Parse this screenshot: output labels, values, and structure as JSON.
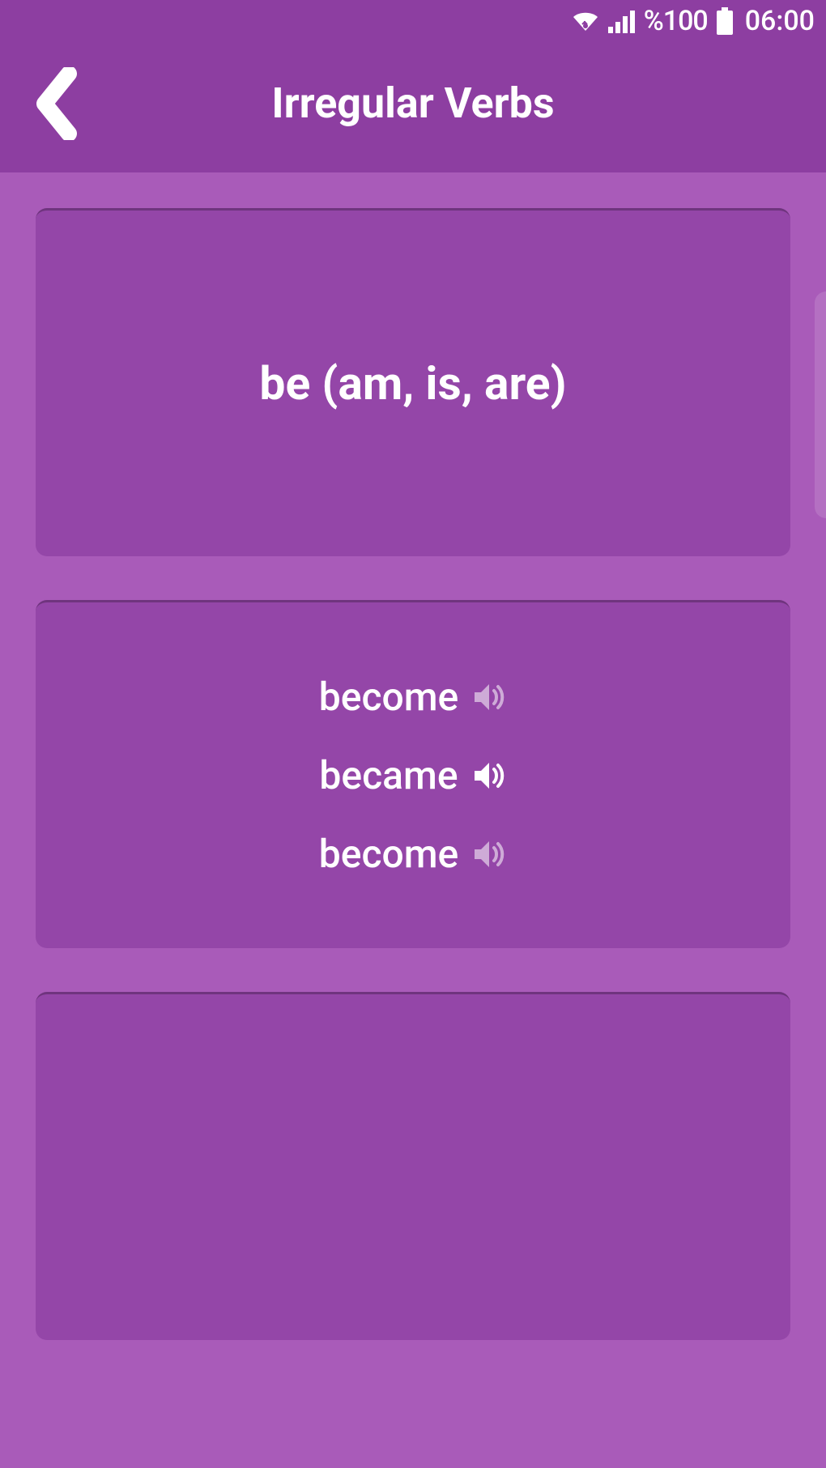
{
  "status": {
    "battery": "%100",
    "clock": "06:00"
  },
  "header": {
    "title": "Irregular Verbs"
  },
  "cards": {
    "main": {
      "verb": "be (am, is, are)"
    },
    "forms": {
      "v1": "become",
      "v2": "became",
      "v3": "become"
    }
  },
  "icons": {
    "wifi": "wifi-icon",
    "signal": "signal-icon",
    "battery": "battery-icon",
    "back": "chevron-left-icon",
    "speaker": "speaker-icon"
  }
}
